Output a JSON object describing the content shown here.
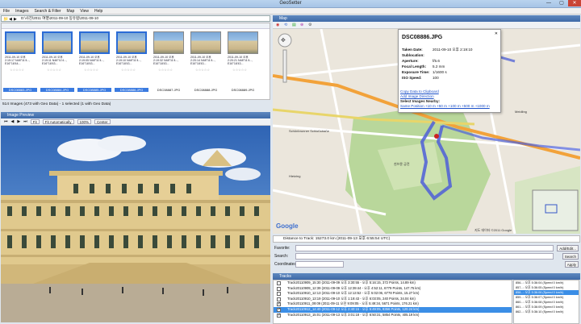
{
  "window": {
    "title": "GeoSetter",
    "minimize": "—",
    "maximize": "▢",
    "close": "✕"
  },
  "menu": [
    "File",
    "Images",
    "Search & Filter",
    "Map",
    "View",
    "Help"
  ],
  "path": {
    "value": "D:\\사진\\2011 여행\\2011-09-10 동유럽\\2011-09-10"
  },
  "thumbnails": [
    {
      "caption": "2011-09-10 오후 2:19:17 N48°11'4..., E16°18'44...",
      "file": "DSC08883.JPG",
      "selected": true
    },
    {
      "caption": "2011-09-10 오후 2:19:11 N48°11'4..., E16°18'43...",
      "file": "DSC08884.JPG",
      "selected": true
    },
    {
      "caption": "2011-09-10 오후 2:19:05 N48°11'4..., E16°18'43...",
      "file": "DSC08885.JPG",
      "selected": true
    },
    {
      "caption": "2011-09-10 오후 2:19:10 N48°11'4..., E16°18'43...",
      "file": "DSC08886.JPG",
      "selected": true
    },
    {
      "caption": "2011-09-10 오후 2:19:32 N48°11'4..., E16°18'43...",
      "file": "DSC08887.JPG",
      "selected": false
    },
    {
      "caption": "2011-09-10 오후 2:20:14 N48°11'4..., E16°18'43...",
      "file": "DSC08888.JPG",
      "selected": false
    },
    {
      "caption": "2011-09-10 오후 2:20:21 N48°11'4..., E16°18'43...",
      "file": "DSC08889.JPG",
      "selected": false
    }
  ],
  "thumb_rating": "☆☆☆☆☆",
  "images_status": "514 Images (473 with Geo Data) - 1 selected (1 with Geo Data)",
  "preview": {
    "header": "Image Preview",
    "fit_label": "Fit",
    "fit_auto": "Fit Automatically",
    "zoom": "100%",
    "center": "Center"
  },
  "map": {
    "header": "Map",
    "google": "Google",
    "copyright": "지도 데이터 ©2011 Google",
    "labels": [
      "Schönbrunner Schloßstraße",
      "Grünbergstraße",
      "쇤브룬 궁전",
      "Hietzing",
      "Meidling"
    ],
    "status": "Distance to Track: 15273.0 km (2011-09-13 오후 6:55:54 UTC)"
  },
  "popup": {
    "title": "DSC08886.JPG",
    "rows": [
      {
        "label": "Taken Date:",
        "value": "2011-09-10 오후 2:19:10"
      },
      {
        "label": "Sublocation:",
        "value": ""
      },
      {
        "label": "Aperture:",
        "value": "f/5.6"
      },
      {
        "label": "Focal Length:",
        "value": "5.2 mm"
      },
      {
        "label": "Exposure Time:",
        "value": "1/1600 s"
      },
      {
        "label": "ISO Speed:",
        "value": "100"
      }
    ],
    "links": [
      "Copy Data to Clipboard",
      "Add Image Direction",
      "Select Images Nearby:",
      "Same Position +10 m +50 m +100 m +500 m +1000 m"
    ]
  },
  "fields": {
    "favorite_label": "Favorite:",
    "favorite_btn": "Add/Edit...",
    "search_label": "Search:",
    "search_btn": "Search",
    "coords_label": "Coordinates:",
    "coords_btn": "Apply"
  },
  "tracks": {
    "header": "Tracks",
    "rows": [
      {
        "text": "Track20110909_15:30 (2011-09-09 오후 3:30:55 - 오후 5:16:15, 372 Points, 14.89 km)",
        "checked": false,
        "selected": false
      },
      {
        "text": "Track20110909_12:39 (2011-09-09 오후 12:39:44 - 오후 4:52:11, 6779 Points, 147.75 km)",
        "checked": false,
        "selected": false
      },
      {
        "text": "Track20110910_12:13 (2011-09-10 오후 12:13:52 - 오후 5:02:06, 6778 Points, 15.27 km)",
        "checked": false,
        "selected": false
      },
      {
        "text": "Track20110910_13:19 (2011-09-10 오후 1:19:43 - 오후 6:03:05, 240 Points, 34.04 km)",
        "checked": false,
        "selected": false
      },
      {
        "text": "Track20110911_09:09 (2011-09-11 오전 9:09:05 - 오후 5:49:34, 5671 Points, 176.21 km)",
        "checked": true,
        "selected": false
      },
      {
        "text": "Track20110912_14:40 (2011-09-12 오후 2:40:15 - 오후 5:49:05, 8356 Points, 120.24 km)",
        "checked": true,
        "selected": true
      },
      {
        "text": "Track20110913_15:01 (2011-09-13 오후 3:01:18 - 오후 6:50:31, 5854 Points, 405.19 km)",
        "checked": true,
        "selected": false
      }
    ],
    "side": [
      "856...: 오후 5:36:04 (Speed 0 km/h)",
      "857...: 오후 5:36:05 (Speed 0 km/h)",
      "858...: 오후 5:36:06 (Speed 0 km/h)",
      "859...: 오후 5:36:07 (Speed 0 km/h)",
      "860...: 오후 5:36:08 (Speed 0 km/h)",
      "861...: 오후 5:36:09 (Speed 0 km/h)",
      "862...: 오후 5:36:10 (Speed 0 km/h)"
    ],
    "side_selected_index": 2
  }
}
